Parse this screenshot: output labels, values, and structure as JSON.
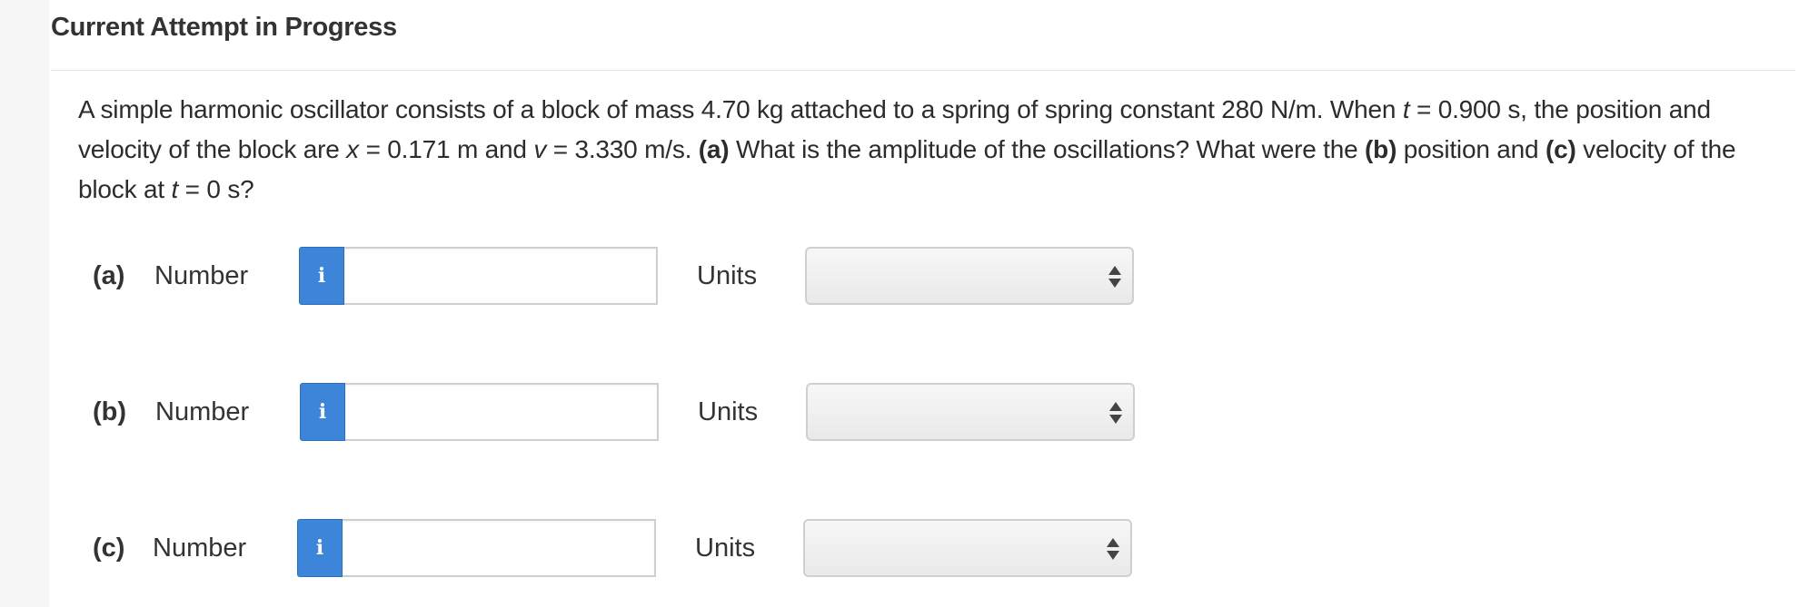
{
  "header": {
    "title": "Current Attempt in Progress"
  },
  "question": {
    "s1": "A simple harmonic oscillator consists of a block of mass 4.70 kg attached to a spring of spring constant 280 N/m. When ",
    "t1": "t",
    "s2": " = 0.900 s, the position and velocity of the block are ",
    "x": "x",
    "s3": " = 0.171 m and ",
    "v": "v",
    "s4": " = 3.330 m/s. ",
    "a_label": "(a)",
    "s5": " What is the amplitude of the oscillations? What were the ",
    "b_label": "(b)",
    "s6": " position and ",
    "c_label": "(c)",
    "s7": " velocity of the block at ",
    "t2": "t",
    "s8": " = 0 s?"
  },
  "parts": [
    {
      "label": "(a)",
      "number_label": "Number",
      "info_icon": "i",
      "value": "",
      "units_label": "Units",
      "units_selected": ""
    },
    {
      "label": "(b)",
      "number_label": "Number",
      "info_icon": "i",
      "value": "",
      "units_label": "Units",
      "units_selected": ""
    },
    {
      "label": "(c)",
      "number_label": "Number",
      "info_icon": "i",
      "value": "",
      "units_label": "Units",
      "units_selected": ""
    }
  ],
  "colors": {
    "info_button": "#3d85d8",
    "text": "#2c2c2c"
  }
}
